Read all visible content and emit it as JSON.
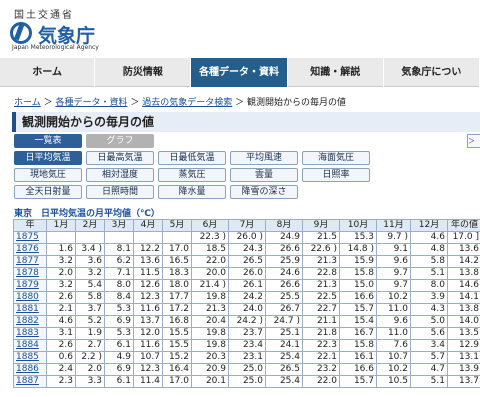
{
  "header": {
    "org_jp": "国土交通省",
    "logo_jp": "気象庁",
    "logo_en": "Japan Meteorological Agency"
  },
  "nav": {
    "items": [
      {
        "label": "ホーム"
      },
      {
        "label": "防災情報"
      },
      {
        "label": "各種データ・資料",
        "active": true
      },
      {
        "label": "知識・解説"
      },
      {
        "label": "気象庁につい"
      }
    ]
  },
  "breadcrumb": [
    "ホーム",
    "各種データ・資料",
    "過去の気象データ検索",
    "観測開始からの毎月の値"
  ],
  "page_title": "観測開始からの毎月の値",
  "view_buttons": {
    "list": "一覧表",
    "graph": "グラフ"
  },
  "side_button": "＞",
  "elements": [
    "日平均気温",
    "日最高気温",
    "日最低気温",
    "平均風速",
    "海面気圧",
    "現地気圧",
    "相対湿度",
    "蒸気圧",
    "雲量",
    "日照率",
    "全天日射量",
    "日照時間",
    "降水量",
    "降雪の深さ"
  ],
  "table_title": "東京　日平均気温の月平均値（℃）",
  "headers": [
    "年",
    "1月",
    "2月",
    "3月",
    "4月",
    "5月",
    "6月",
    "7月",
    "8月",
    "9月",
    "10月",
    "11月",
    "12月",
    "年の値"
  ],
  "rows": [
    [
      "1875",
      "",
      "",
      "",
      "",
      "",
      "22.3 )",
      "26.0 )",
      "24.9",
      "21.5",
      "15.3",
      "9.7 )",
      "4.6",
      "17.0 ]"
    ],
    [
      "1876",
      "1.6",
      "3.4 )",
      "8.1",
      "12.2",
      "17.0",
      "18.5",
      "24.3",
      "26.6",
      "22.6 )",
      "14.8 )",
      "9.1",
      "4.8",
      "13.6"
    ],
    [
      "1877",
      "3.2",
      "3.6",
      "6.2",
      "13.6",
      "16.5",
      "22.0",
      "26.5",
      "25.9",
      "21.3",
      "15.9",
      "9.6",
      "5.8",
      "14.2"
    ],
    [
      "1878",
      "2.0",
      "3.2",
      "7.1",
      "11.5",
      "18.3",
      "20.0",
      "26.0",
      "24.6",
      "22.8",
      "15.8",
      "9.7",
      "5.1",
      "13.8"
    ],
    [
      "1879",
      "3.2",
      "5.4",
      "8.0",
      "12.6",
      "18.0",
      "21.4 )",
      "26.1",
      "26.6",
      "21.3",
      "15.0",
      "9.7",
      "8.0",
      "14.6"
    ],
    [
      "1880",
      "2.6",
      "5.8",
      "8.4",
      "12.3",
      "17.7",
      "19.8",
      "24.2",
      "25.5",
      "22.5",
      "16.6",
      "10.2",
      "3.9",
      "14.1"
    ],
    [
      "1881",
      "2.1",
      "3.7",
      "5.3",
      "11.6",
      "17.2",
      "21.3",
      "24.0",
      "26.7",
      "22.7",
      "15.7",
      "11.0",
      "4.3",
      "13.8"
    ],
    [
      "1882",
      "4.6",
      "5.2",
      "6.9",
      "13.7",
      "16.8",
      "20.4",
      "24.2 )",
      "24.7 )",
      "21.1",
      "15.4",
      "9.6",
      "5.0",
      "14.0"
    ],
    [
      "1883",
      "3.1",
      "1.9",
      "5.3",
      "12.0",
      "15.5",
      "19.8",
      "23.7",
      "25.1",
      "21.8",
      "16.7",
      "11.0",
      "5.6",
      "13.5"
    ],
    [
      "1884",
      "2.6",
      "2.7",
      "6.1",
      "11.6",
      "15.5",
      "19.8",
      "23.4",
      "24.1",
      "22.3",
      "15.8",
      "7.6",
      "3.4",
      "12.9"
    ],
    [
      "1885",
      "0.6",
      "2.2 )",
      "4.9",
      "10.7",
      "15.2",
      "20.3",
      "23.1",
      "25.4",
      "22.1",
      "16.1",
      "10.7",
      "5.7",
      "13.1"
    ],
    [
      "1886",
      "2.4",
      "2.0",
      "6.9",
      "12.3",
      "16.4",
      "20.9",
      "25.0",
      "26.5",
      "23.2",
      "16.6",
      "10.2",
      "4.7",
      "13.9"
    ],
    [
      "1887",
      "2.3",
      "3.3",
      "6.1",
      "11.4",
      "17.0",
      "20.1",
      "25.0",
      "25.4",
      "22.0",
      "15.7",
      "10.5",
      "5.1",
      "13.7"
    ]
  ]
}
